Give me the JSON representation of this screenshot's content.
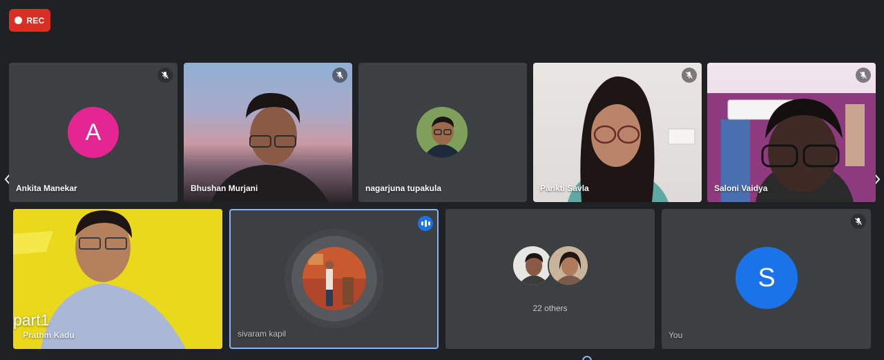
{
  "recording": {
    "label": "REC"
  },
  "overlay": {
    "part_label": "part1"
  },
  "participants": {
    "ankita": {
      "name": "Ankita Manekar",
      "initial": "A",
      "avatar_color": "#e52592"
    },
    "bhushan": {
      "name": "Bhushan Murjani"
    },
    "nagarjuna": {
      "name": "nagarjuna tupakula"
    },
    "pankti": {
      "name": "Pankti Savla"
    },
    "saloni": {
      "name": "Saloni Vaidya"
    },
    "prathm": {
      "name": "Prathm Kadu"
    },
    "sivaram": {
      "name": "sivaram kapil"
    },
    "others": {
      "label": "22 others"
    },
    "you": {
      "name": "You",
      "initial": "S",
      "avatar_color": "#1a73e8"
    }
  },
  "icons": {
    "mic_off": "mic-off-icon",
    "speaking": "speaking-indicator-icon",
    "prev": "chevron-left-icon",
    "next": "chevron-right-icon"
  },
  "colors": {
    "background": "#202124",
    "tile": "#3c4043",
    "rec": "#d93025",
    "active_border": "#8ab4f8"
  }
}
